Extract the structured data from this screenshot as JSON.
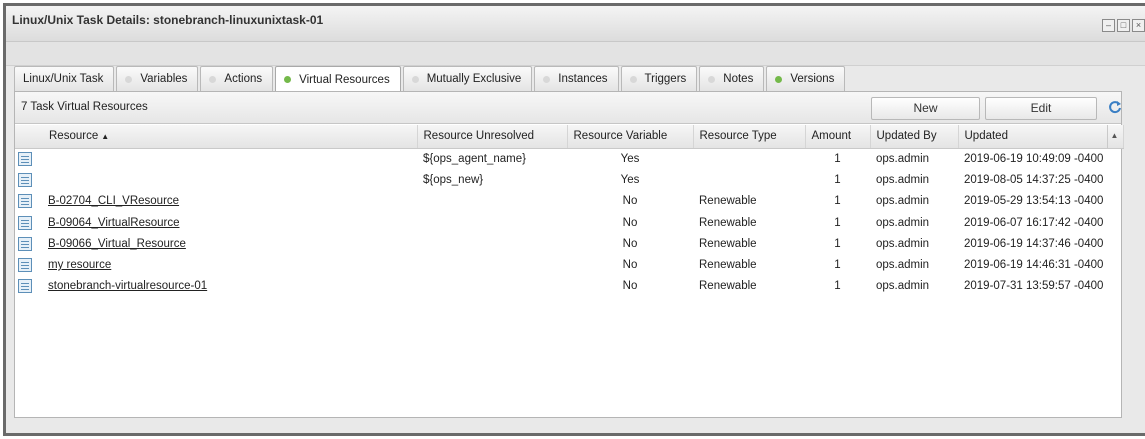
{
  "window": {
    "title": "Linux/Unix Task Details: stonebranch-linuxunixtask-01"
  },
  "tabs": [
    {
      "label": "Linux/Unix Task",
      "dot": "none"
    },
    {
      "label": "Variables",
      "dot": "grey"
    },
    {
      "label": "Actions",
      "dot": "grey"
    },
    {
      "label": "Virtual Resources",
      "dot": "green",
      "active": true
    },
    {
      "label": "Mutually Exclusive",
      "dot": "grey"
    },
    {
      "label": "Instances",
      "dot": "grey"
    },
    {
      "label": "Triggers",
      "dot": "grey"
    },
    {
      "label": "Notes",
      "dot": "grey"
    },
    {
      "label": "Versions",
      "dot": "green"
    }
  ],
  "panel": {
    "count_label": "7 Task Virtual Resources",
    "new_label": "New",
    "edit_label": "Edit",
    "refresh_icon": "refresh-icon"
  },
  "table": {
    "columns": [
      "Resource",
      "Resource Unresolved",
      "Resource Variable",
      "Resource Type",
      "Amount",
      "Updated By",
      "Updated"
    ],
    "sort_column": "Resource",
    "sort_dir": "asc",
    "rows": [
      {
        "resource": "",
        "unresolved": "${ops_agent_name}",
        "variable": "Yes",
        "type": "",
        "amount": "1",
        "updated_by": "ops.admin",
        "updated": "2019-06-19 10:49:09 -0400"
      },
      {
        "resource": "",
        "unresolved": "${ops_new}",
        "variable": "Yes",
        "type": "",
        "amount": "1",
        "updated_by": "ops.admin",
        "updated": "2019-08-05 14:37:25 -0400"
      },
      {
        "resource": "B-02704_CLI_VResource",
        "unresolved": "",
        "variable": "No",
        "type": "Renewable",
        "amount": "1",
        "updated_by": "ops.admin",
        "updated": "2019-05-29 13:54:13 -0400"
      },
      {
        "resource": "B-09064_VirtualResource",
        "unresolved": "",
        "variable": "No",
        "type": "Renewable",
        "amount": "1",
        "updated_by": "ops.admin",
        "updated": "2019-06-07 16:17:42 -0400"
      },
      {
        "resource": "B-09066_Virtual_Resource",
        "unresolved": "",
        "variable": "No",
        "type": "Renewable",
        "amount": "1",
        "updated_by": "ops.admin",
        "updated": "2019-06-19 14:37:46 -0400"
      },
      {
        "resource": "my resource",
        "unresolved": "",
        "variable": "No",
        "type": "Renewable",
        "amount": "1",
        "updated_by": "ops.admin",
        "updated": "2019-06-19 14:46:31 -0400"
      },
      {
        "resource": "stonebranch-virtualresource-01",
        "unresolved": "",
        "variable": "No",
        "type": "Renewable",
        "amount": "1",
        "updated_by": "ops.admin",
        "updated": "2019-07-31 13:59:57 -0400"
      }
    ]
  }
}
